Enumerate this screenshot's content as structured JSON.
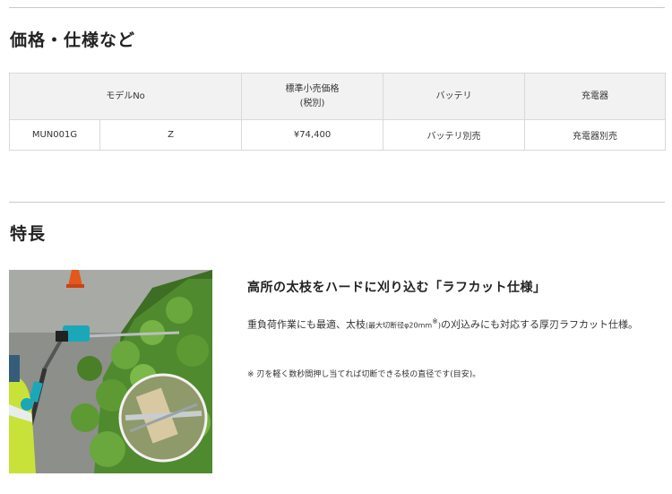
{
  "sections": {
    "price_title": "価格・仕様など",
    "feature_title": "特長"
  },
  "spec_table": {
    "headers": {
      "model": "モデルNo",
      "price_line1": "標準小売価格",
      "price_line2": "(税別)",
      "battery": "バッテリ",
      "charger": "充電器"
    },
    "row": {
      "model": "MUN001G",
      "variant": "Z",
      "price": "¥74,400",
      "battery": "バッテリ別売",
      "charger": "充電器別売"
    }
  },
  "feature": {
    "heading": "高所の太枝をハードに刈り込む「ラフカット仕様」",
    "body_pre": "重負荷作業にも最適、太枝",
    "body_small": "(最大切断径",
    "body_phi": "φ",
    "body_size": "20mm",
    "body_mark": "※",
    "body_close": ")",
    "body_post": "の刈込みにも対応する厚刃ラフカット仕様。",
    "note": "※ 刃を軽く数秒間押し当てれば切断できる枝の直径です(目安)。"
  },
  "colors": {
    "rule": "#c9c9c9",
    "header_bg": "#f2f2f2",
    "hedge_green": "#4f8a2e",
    "tool_teal": "#1aa7b8",
    "vest_yellow": "#c8e23a"
  }
}
